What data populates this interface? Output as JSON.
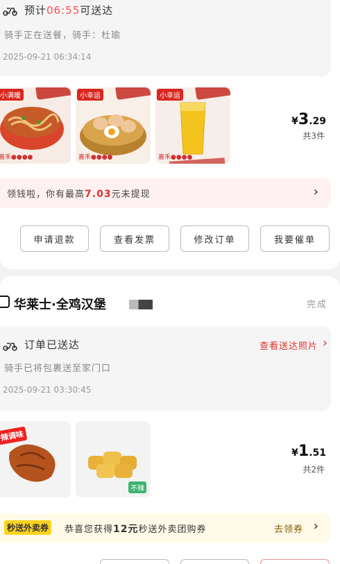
{
  "order1": {
    "eta_prefix": "预计",
    "eta_time": "06:55",
    "eta_suffix": "可送达",
    "rider_status": "骑手正在送餐，骑手：杜瑜",
    "timestamp": "2025-09-21 06:34:14",
    "items": [
      {
        "tag": "小满暖",
        "mark": "嘉禾●●●●",
        "icon": "noodle-bowl"
      },
      {
        "tag": "小幸运",
        "mark": "嘉禾●●●●",
        "icon": "eggs-basket"
      },
      {
        "tag": "小幸运",
        "mark": "嘉禾●●●●",
        "icon": "juice-glass"
      }
    ],
    "price_symbol": "¥",
    "price_int": "3",
    "price_dec": ".29",
    "item_count": "共3件",
    "promo_prefix": "领钱啦，你有最高",
    "promo_amount": "7.03",
    "promo_suffix": "元未提现",
    "buttons": [
      "申请退款",
      "查看发票",
      "修改订单",
      "我要催单"
    ]
  },
  "order2": {
    "shop_name": "华莱士·全鸡汉堡",
    "state": "完成",
    "status_title": "订单已送达",
    "photo_link": "查看送达照片",
    "rider_status": "骑手已将包裹送至家门口",
    "timestamp": "2025-09-21 03:30:45",
    "items": [
      {
        "tag": "香辣调味",
        "icon": "chicken-wing"
      },
      {
        "tag": "不辣",
        "icon": "nuggets"
      }
    ],
    "price_symbol": "¥",
    "price_int": "1",
    "price_dec": ".51",
    "item_count": "共2件",
    "coupon_tag": "秒送外卖券",
    "coupon_prefix": "恭喜您获得",
    "coupon_amount": "12元",
    "coupon_suffix": "秒送外卖团购券",
    "coupon_link": "去领券"
  },
  "colors": {
    "accent_red": "#e0312c",
    "eta_red": "#ff4d4f",
    "coupon_yellow": "#ffd21f"
  }
}
